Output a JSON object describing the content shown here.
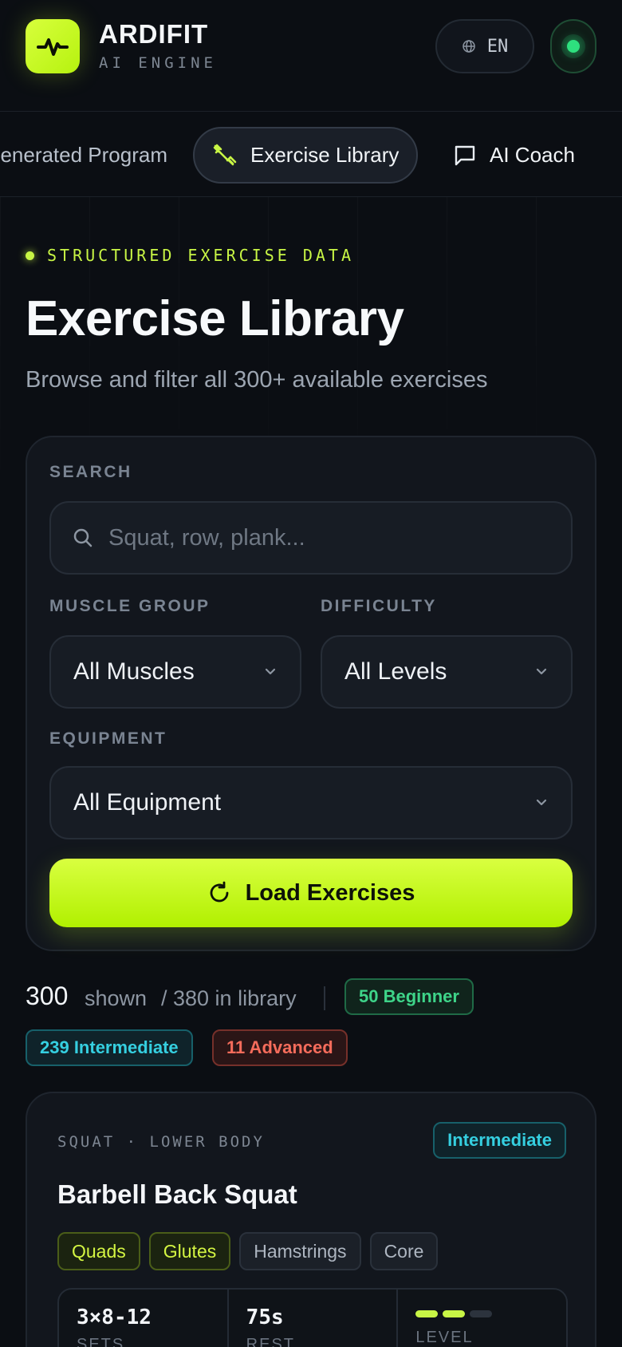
{
  "header": {
    "brand_name": "ARDIFIT",
    "brand_sub": "AI ENGINE",
    "language": "EN",
    "accent_color": "#c8f545",
    "status_color": "#2ee07e"
  },
  "nav": {
    "tabs": [
      {
        "label": "Generated Program",
        "visible_label": "enerated Program"
      },
      {
        "label": "Exercise Library",
        "active": true,
        "icon": "dumbbell-icon"
      },
      {
        "label": "AI Coach",
        "icon": "chat-bubble-icon"
      }
    ]
  },
  "hero": {
    "eyebrow": "STRUCTURED EXERCISE DATA",
    "title": "Exercise Library",
    "subtitle": "Browse and filter all 300+ available exercises"
  },
  "filters": {
    "search_label": "SEARCH",
    "search_placeholder": "Squat, row, plank...",
    "search_value": "",
    "muscle_label": "MUSCLE GROUP",
    "muscle_value": "All Muscles",
    "difficulty_label": "DIFFICULTY",
    "difficulty_value": "All Levels",
    "equipment_label": "EQUIPMENT",
    "equipment_value": "All Equipment",
    "load_button": "Load Exercises"
  },
  "stats": {
    "shown_count": "300",
    "shown_label": "shown",
    "total_label": "/ 380 in library",
    "beginner": "50 Beginner",
    "intermediate": "239 Intermediate",
    "advanced": "11 Advanced"
  },
  "exercises": [
    {
      "category": "SQUAT · LOWER BODY",
      "level": "Intermediate",
      "title": "Barbell Back Squat",
      "primary_muscles": [
        "Quads",
        "Glutes"
      ],
      "secondary_muscles": [
        "Hamstrings",
        "Core"
      ],
      "sets": "3×8-12",
      "sets_label": "SETS",
      "rest": "75s",
      "rest_label": "REST",
      "level_label": "LEVEL",
      "level_value": 2,
      "level_max": 3
    }
  ]
}
